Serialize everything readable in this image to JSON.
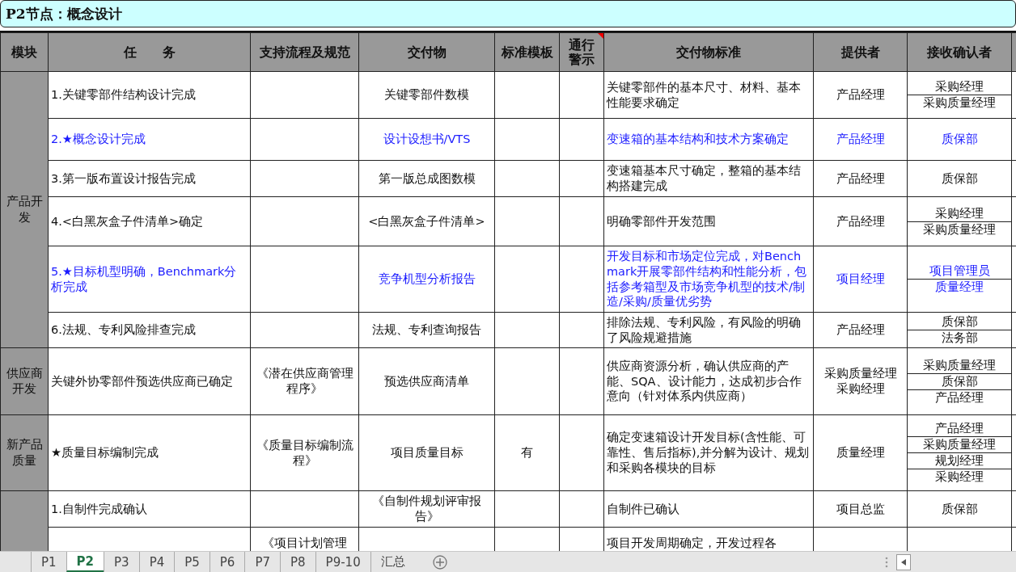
{
  "title": "P2节点：概念设计",
  "columns": [
    {
      "label": "模块",
      "comment": false
    },
    {
      "label": "任　　务",
      "comment": false
    },
    {
      "label": "支持流程及规范",
      "comment": false
    },
    {
      "label": "交付物",
      "comment": false
    },
    {
      "label": "标准模板",
      "comment": false
    },
    {
      "label": "通行警示",
      "comment": true
    },
    {
      "label": "交付物标准",
      "comment": false
    },
    {
      "label": "提供者",
      "comment": false
    },
    {
      "label": "接收确认者",
      "comment": false
    }
  ],
  "sections": [
    {
      "module": "产品开发",
      "rows": [
        {
          "task": "1.关键零部件结构设计完成",
          "deliverable": "关键零部件数模",
          "standard": "关键零部件的基本尺寸、材料、基本性能要求确定",
          "provider": "产品经理",
          "receivers": [
            "采购经理",
            "采购质量经理"
          ],
          "highlight": false
        },
        {
          "task": "2.★概念设计完成",
          "deliverable": "设计设想书/VTS",
          "standard": "变速箱的基本结构和技术方案确定",
          "provider": "产品经理",
          "receivers": [
            "质保部"
          ],
          "highlight": true
        },
        {
          "task": "3.第一版布置设计报告完成",
          "deliverable": "第一版总成图数模",
          "standard": "变速箱基本尺寸确定，整箱的基本结构搭建完成",
          "provider": "产品经理",
          "receivers": [
            "质保部"
          ],
          "highlight": false
        },
        {
          "task": "4.<白黑灰盒子件清单>确定",
          "deliverable": "<白黑灰盒子件清单>",
          "standard": "明确零部件开发范围",
          "provider": "产品经理",
          "receivers": [
            "采购经理",
            "采购质量经理"
          ],
          "highlight": false
        },
        {
          "task": "5.★目标机型明确，Benchmark分析完成",
          "deliverable": "竞争机型分析报告",
          "standard": "开发目标和市场定位完成，对Benchmark开展零部件结构和性能分析，包括参考箱型及市场竞争机型的技术/制造/采购/质量优劣势",
          "provider": "项目经理",
          "receivers": [
            "项目管理员",
            "质量经理"
          ],
          "highlight": true
        },
        {
          "task": "6.法规、专利风险排查完成",
          "deliverable": "法规、专利查询报告",
          "standard": "排除法规、专利风险，有风险的明确了风险规避措施",
          "provider": "产品经理",
          "receivers": [
            "质保部",
            "法务部"
          ],
          "highlight": false
        }
      ]
    },
    {
      "module": "供应商开发",
      "rows": [
        {
          "task": "关键外协零部件预选供应商已确定",
          "process": "《潜在供应商管理程序》",
          "deliverable": "预选供应商清单",
          "standard": "供应商资源分析，确认供应商的产能、SQA、设计能力，达成初步合作意向（针对体系内供应商）",
          "provider": [
            "采购质量经理",
            "采购经理"
          ],
          "receivers": [
            "采购质量经理",
            "质保部",
            "产品经理"
          ],
          "highlight": false
        }
      ]
    },
    {
      "module": "新产品质量",
      "rows": [
        {
          "task": "★质量目标编制完成",
          "process": "《质量目标编制流程》",
          "deliverable": "项目质量目标",
          "template": "有",
          "standard": "确定变速箱设计开发目标(含性能、可靠性、售后指标),并分解为设计、规划和采购各模块的目标",
          "provider": "质量经理",
          "receivers": [
            "产品经理",
            "采购质量经理",
            "规划经理",
            "采购经理"
          ],
          "highlight": false
        }
      ]
    },
    {
      "rows": [
        {
          "task": "1.自制件完成确认",
          "deliverable": "《自制件规划评审报告》",
          "standard": "自制件已确认",
          "provider": "项目总监",
          "receivers": [
            "质保部"
          ],
          "highlight": false
        },
        {
          "process": "《项目计划管理",
          "standard": "项目开发周期确定，开发过程各",
          "receivers": [],
          "highlight": false
        }
      ]
    }
  ],
  "sheet_tabs": [
    {
      "label": "P1",
      "selected": false
    },
    {
      "label": "P2",
      "selected": true
    },
    {
      "label": "P3",
      "selected": false
    },
    {
      "label": "P4",
      "selected": false
    },
    {
      "label": "P5",
      "selected": false
    },
    {
      "label": "P6",
      "selected": false
    },
    {
      "label": "P7",
      "selected": false
    },
    {
      "label": "P8",
      "selected": false
    },
    {
      "label": "P9-10",
      "selected": false
    },
    {
      "label": "汇总",
      "selected": false
    }
  ]
}
